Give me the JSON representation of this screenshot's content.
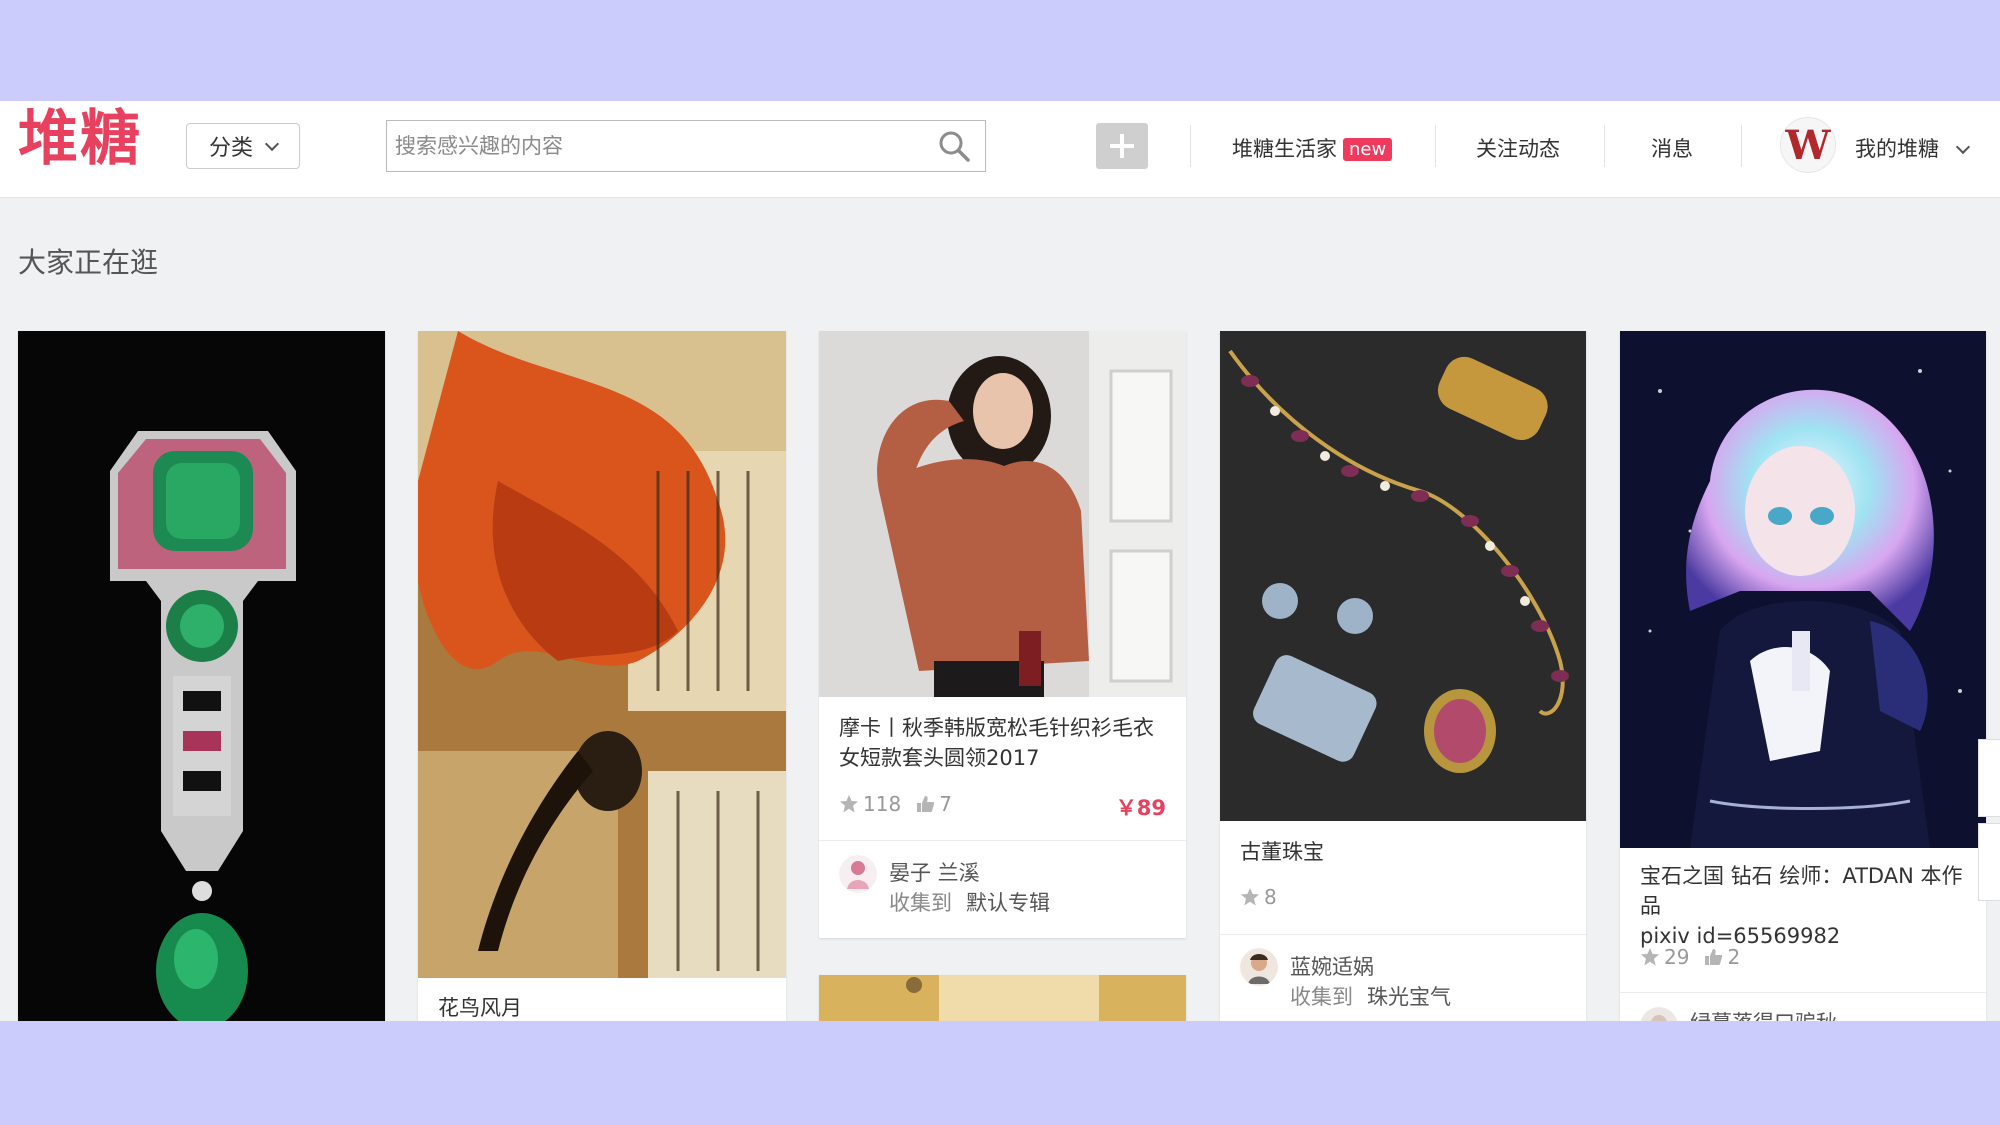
{
  "header": {
    "logo": "堆糖",
    "category_label": "分类",
    "search_placeholder": "搜索感兴趣的内容",
    "nav": {
      "lifehome": "堆糖生活家",
      "new_badge": "new",
      "follow": "关注动态",
      "messages": "消息",
      "my_duitang": "我的堆糖"
    }
  },
  "section_title": "大家正在逛",
  "cards": [
    {
      "caption": ""
    },
    {
      "caption": "花鸟风月"
    },
    {
      "caption": "摩卡丨秋季韩版宽松毛针织衫毛衣女短款套头圆领2017",
      "stars": "118",
      "likes": "7",
      "price": "￥89",
      "user": "晏子 兰溪",
      "collect_prefix": "收集到",
      "album": "默认专辑"
    },
    {
      "caption": "古董珠宝",
      "stars": "8",
      "user": "蓝婉适娲",
      "collect_prefix": "收集到",
      "album": "珠光宝气"
    },
    {
      "caption_line1": "宝石之国 钻石 绘师：ATDAN 本作品",
      "caption_line2": "pixiv id=65569982",
      "stars": "29",
      "likes": "2",
      "user": "绿蔓落得口骗秋"
    }
  ],
  "colors": {
    "brand": "#e8415f",
    "frame": "#cbcbfc",
    "page_bg": "#f0f1f3"
  }
}
